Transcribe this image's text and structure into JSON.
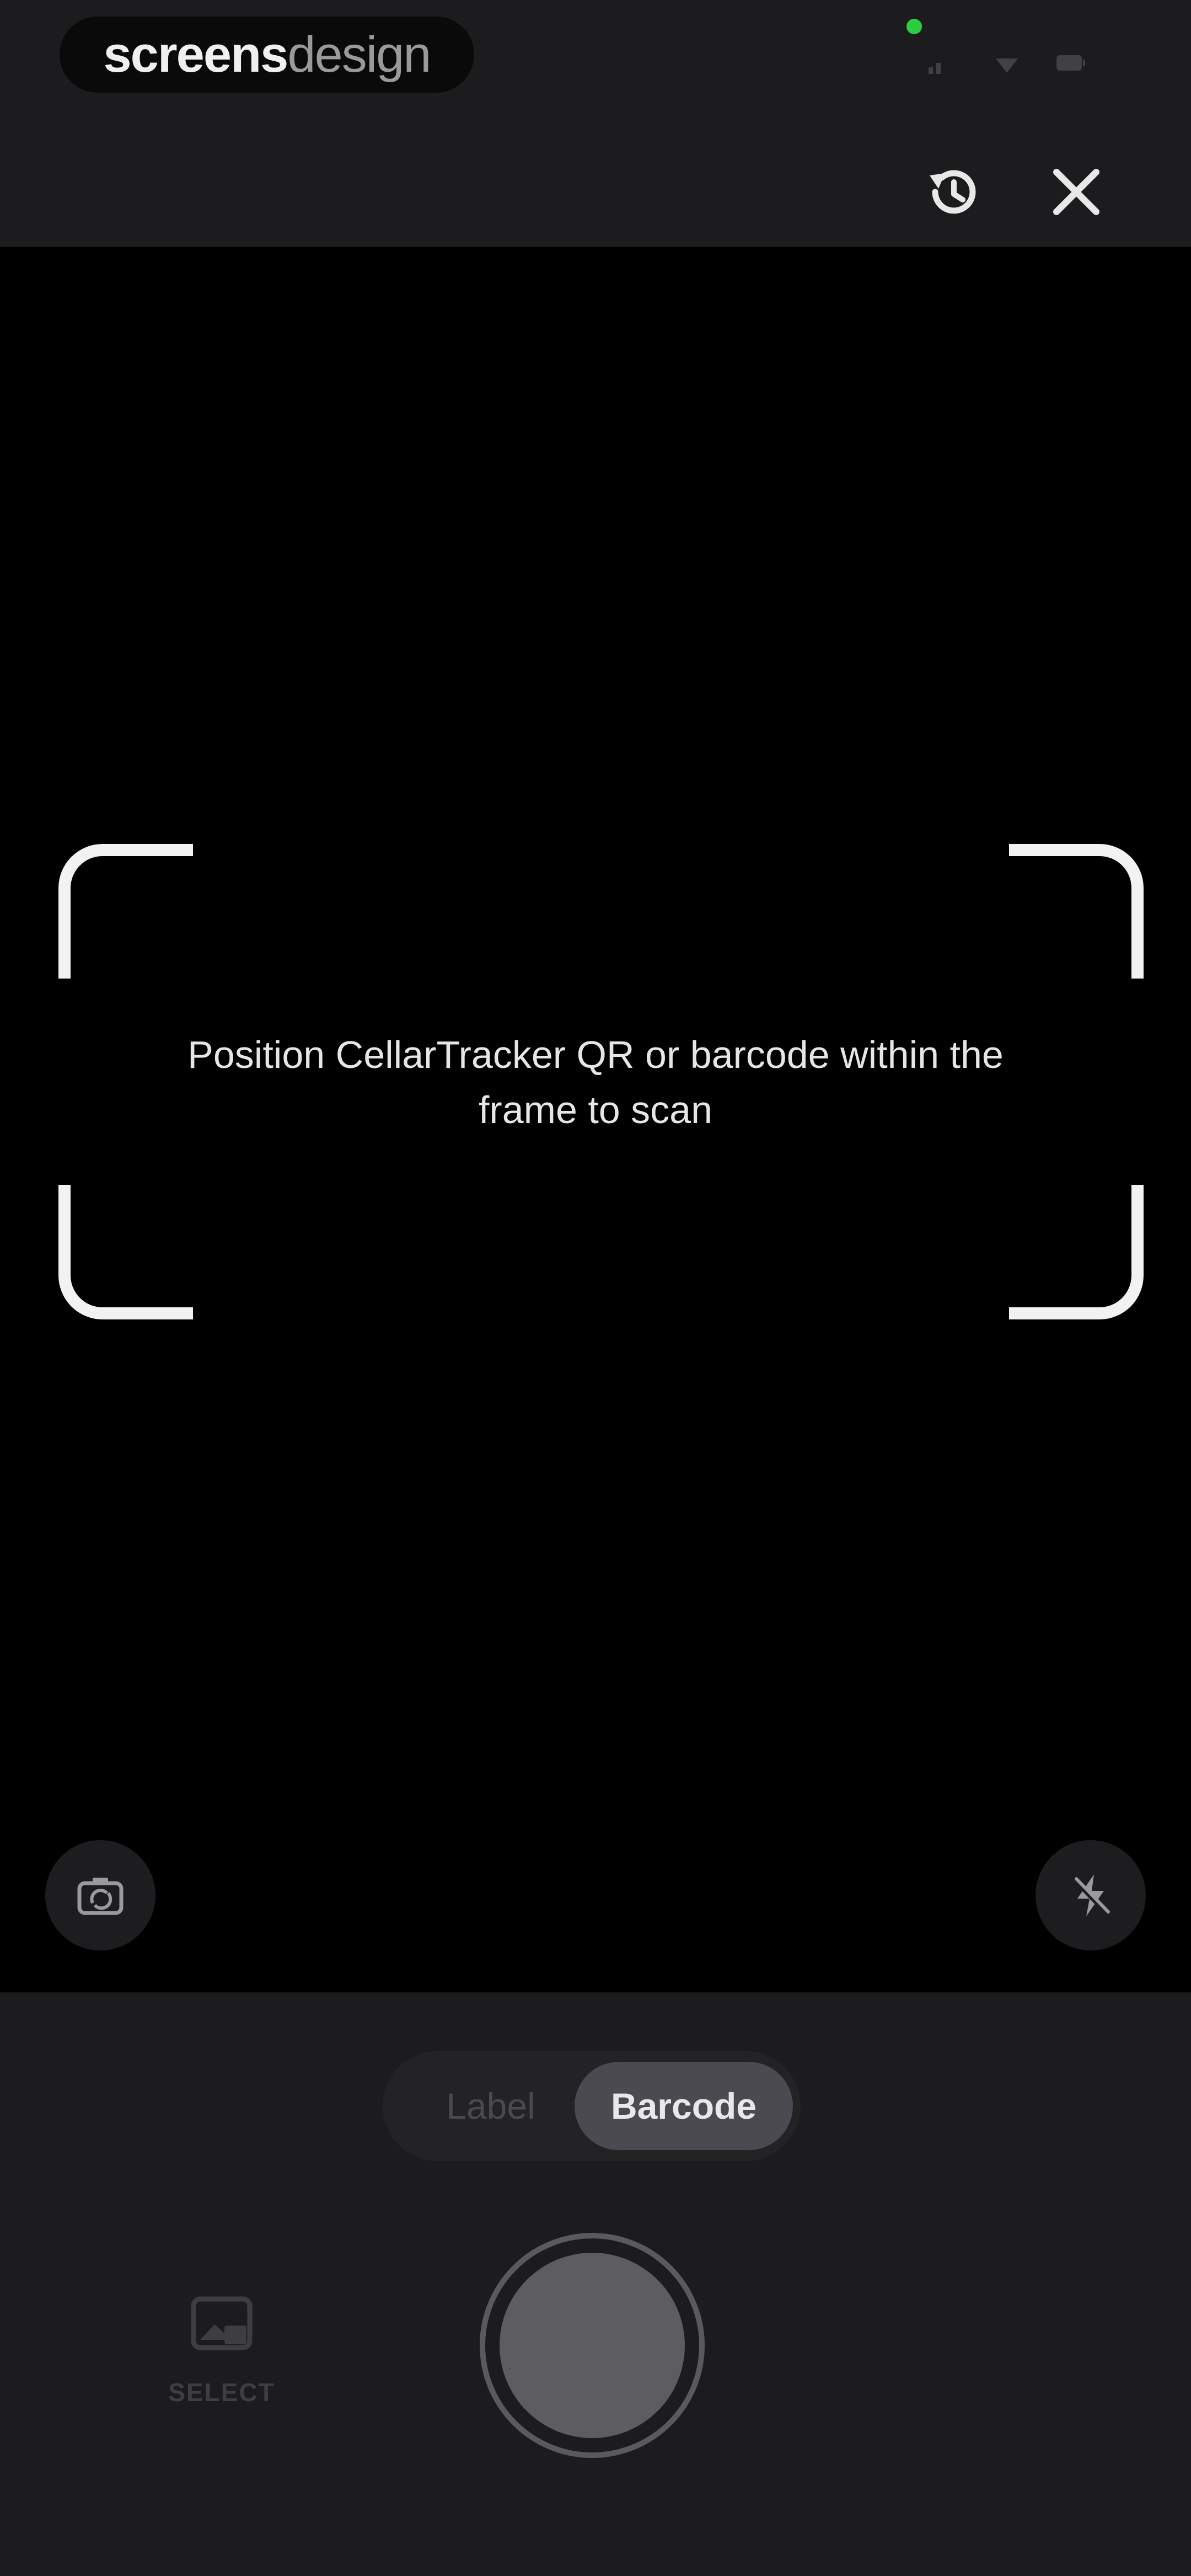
{
  "brand": {
    "part1": "screens",
    "part2": "design"
  },
  "header": {
    "history_icon": "history-icon",
    "close_icon": "close-icon"
  },
  "scanner": {
    "instruction_line1": "Position CellarTracker QR or barcode within the",
    "instruction_line2": "frame to scan"
  },
  "camera_controls": {
    "left_icon": "camera-switch-icon",
    "right_icon": "flash-off-icon"
  },
  "mode_switch": {
    "options": [
      "Label",
      "Barcode"
    ],
    "selected": "Barcode"
  },
  "bottom": {
    "select_label": "SELECT",
    "select_icon": "image-icon",
    "shutter_icon": "shutter-button"
  },
  "colors": {
    "background": "#000000",
    "panel": "#1c1c1e",
    "status_dot": "#2ecc40",
    "selected_segment": "#4b4a50"
  }
}
